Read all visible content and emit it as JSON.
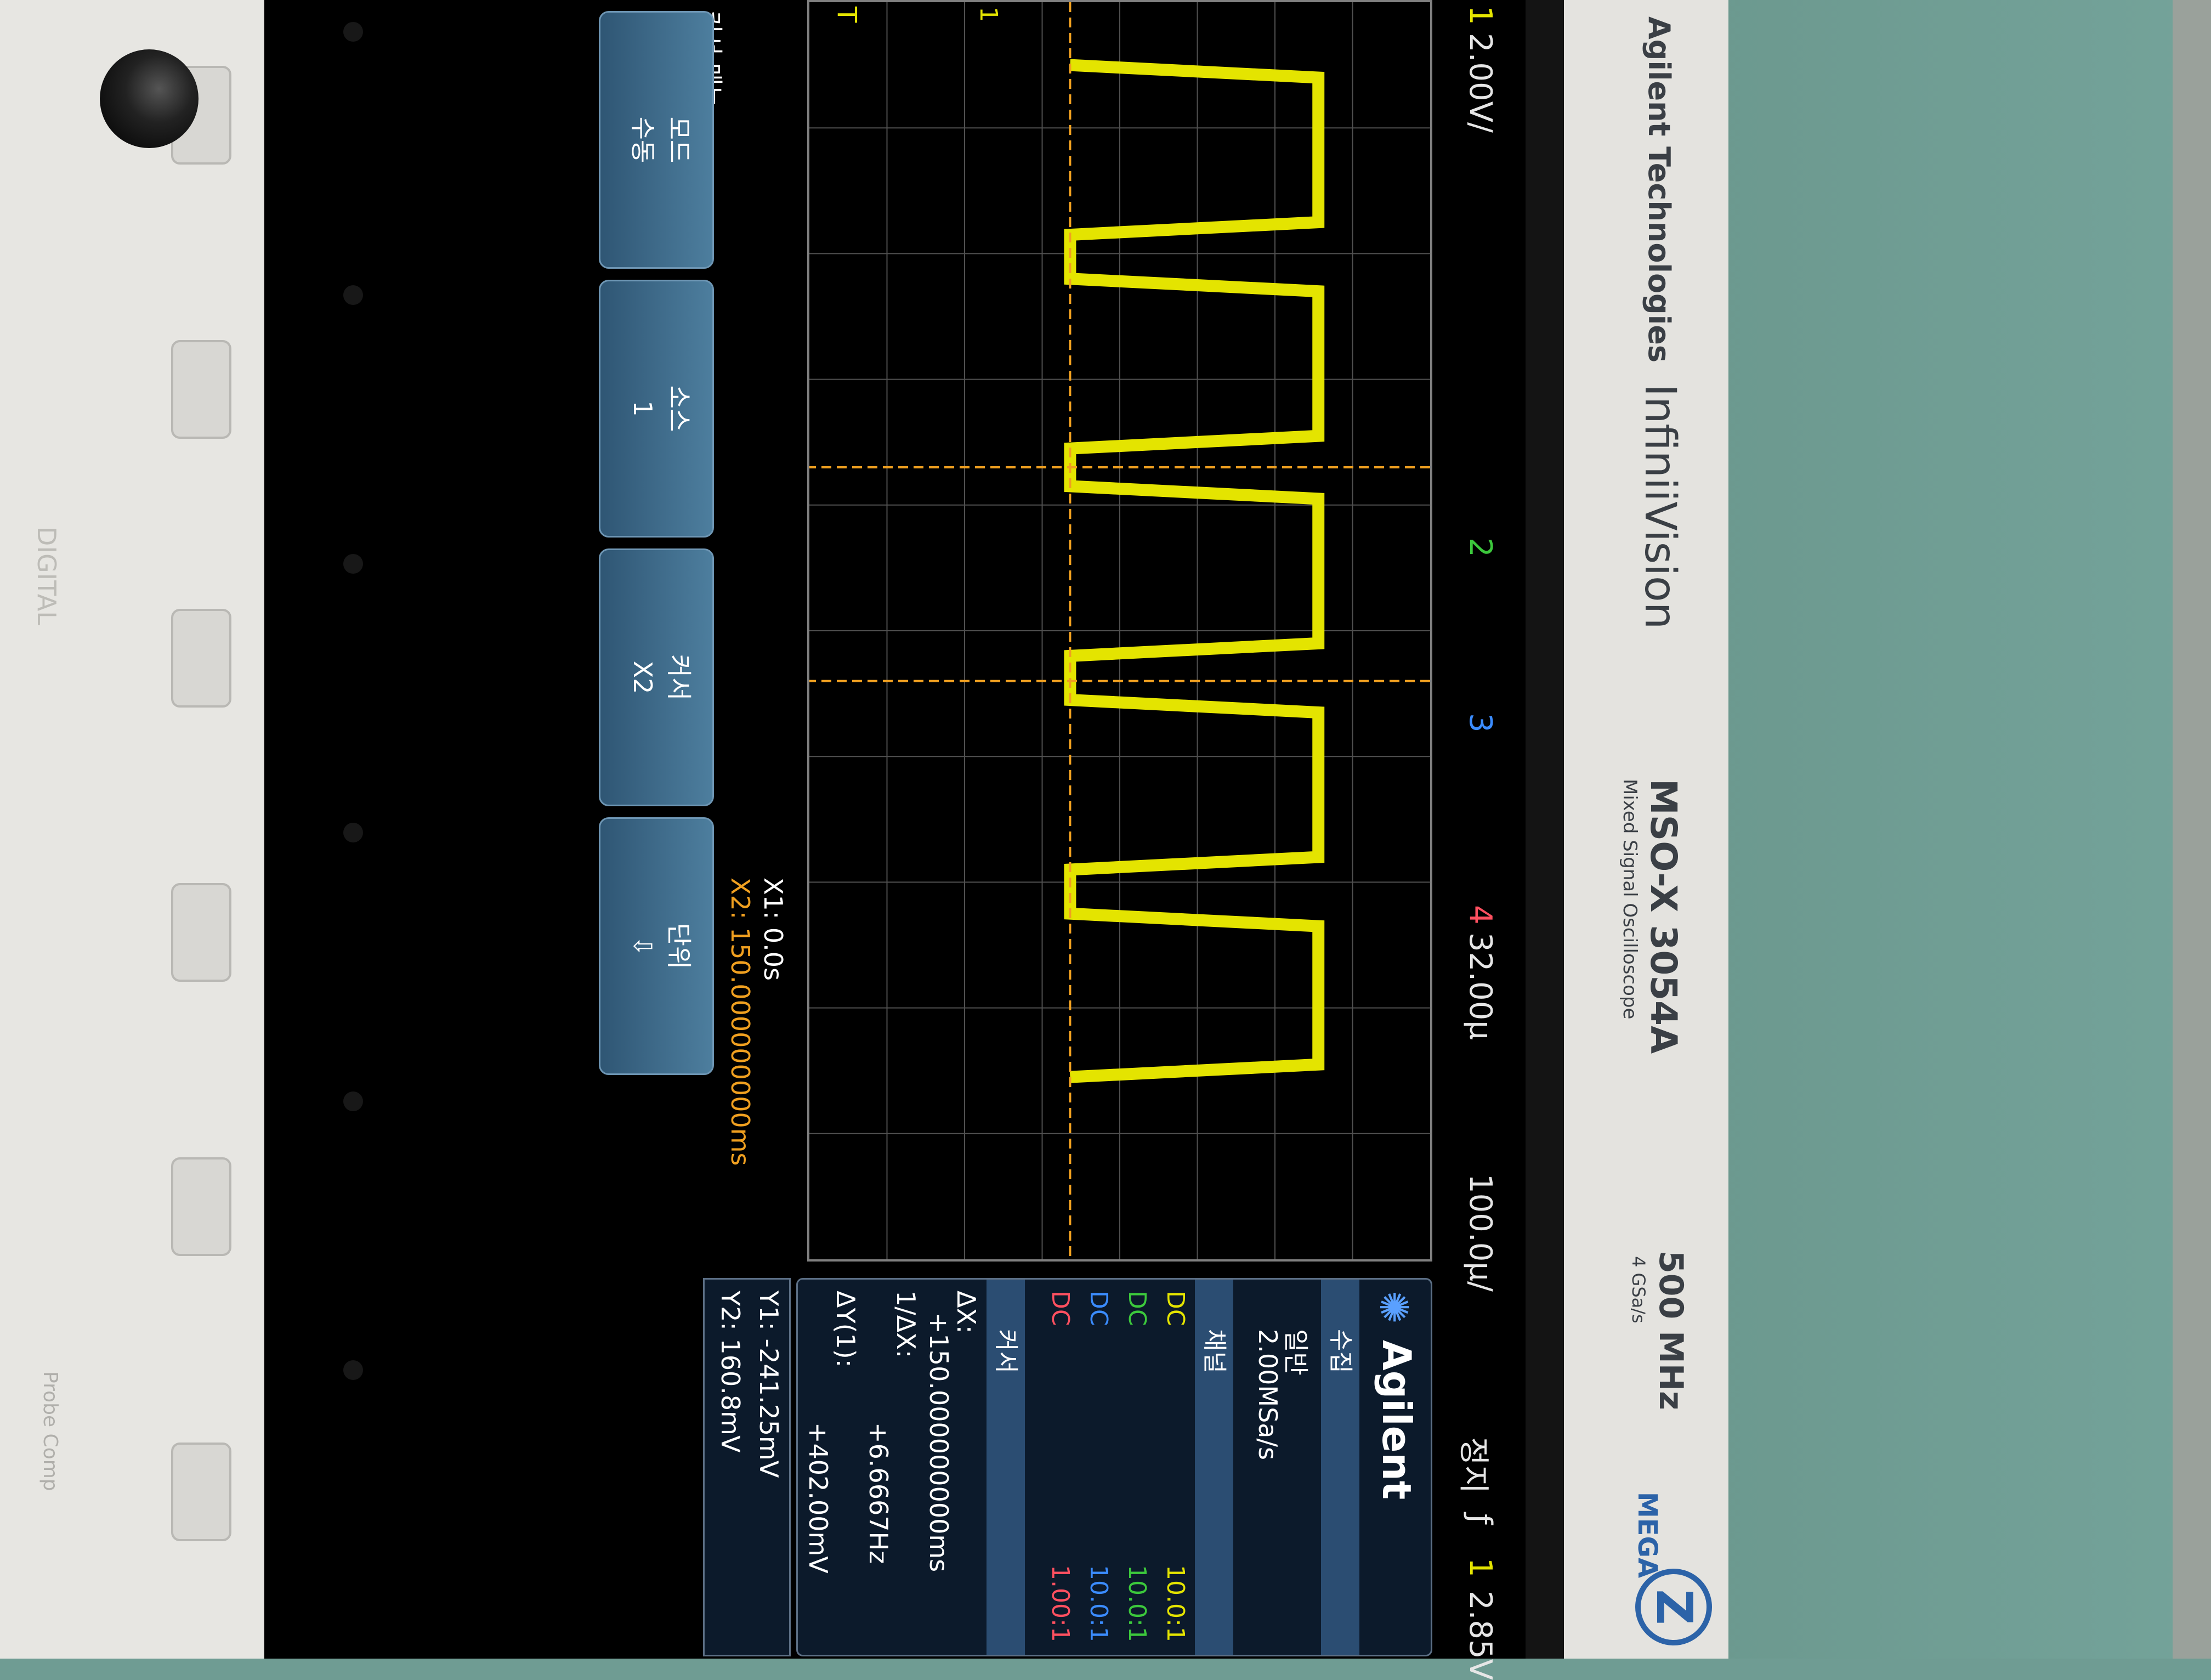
{
  "instrument": {
    "brand_left": "Agilent Technologies",
    "product": "InfiniiVision",
    "model": "MSO-X 3054A",
    "model_sub": "Mixed Signal Oscilloscope",
    "bandwidth": "500 MHz",
    "sample_rate_spec": "4 GSa/s",
    "mega_logo": "MEGA",
    "mega_z": "Z",
    "digital_label": "DIGITAL",
    "probe_comp": "Probe Comp"
  },
  "top_bar": {
    "ch1_num": "1",
    "volts_per_div": "2.00V/",
    "ch2_num": "2",
    "ch3_num": "3",
    "ch4_num": "4",
    "time_pos": "32.00µ",
    "time_per_div": "100.0µ/",
    "run_state": "정지",
    "trigger_icon": "ƒ",
    "trigger_ch": "1",
    "trigger_level": "2.85V"
  },
  "info_panel": {
    "logo": "Agilent",
    "acq_header": "수집",
    "acq_mode": "일반",
    "acq_rate": "2.00MSa/s",
    "channel_header": "채널",
    "channels": [
      {
        "coupling": "DC",
        "scale": "10.0:1",
        "color": "#e4e400"
      },
      {
        "coupling": "DC",
        "scale": "10.0:1",
        "color": "#3cc83c"
      },
      {
        "coupling": "DC",
        "scale": "10.0:1",
        "color": "#3b8cff"
      },
      {
        "coupling": "DC",
        "scale": "1.00:1",
        "color": "#ff5060"
      }
    ],
    "cursor_header": "커서",
    "dx_label": "ΔX:",
    "dx_value": "+150.000000000ms",
    "inv_dx_label": "1/ΔX:",
    "inv_dx_value": "+6.6667Hz",
    "dy_label": "ΔY(1):",
    "dy_value": "+402.00mV"
  },
  "cursor_readout": {
    "y1": "Y1: -241.25mV",
    "y2": "Y2: 160.8mV",
    "x1": "X1: 0.0s",
    "x2": "X2: 150.000000000ms"
  },
  "softkeys": {
    "menu_title": "커서 메뉴",
    "mode": {
      "label": "모드",
      "value": "수동"
    },
    "source": {
      "label": "소스",
      "value": "1"
    },
    "cursor": {
      "label": "커서",
      "value": "X2"
    },
    "units": {
      "label": "단위",
      "value": "⇩"
    }
  },
  "markers": {
    "trigger_marker": "T",
    "ground_marker": "1"
  },
  "colors": {
    "ch1": "#e4e400",
    "cursor": "#f0a020",
    "grid": "#505050",
    "softkey": "#3d6a8a"
  },
  "chart_data": {
    "type": "line",
    "title": "",
    "xlabel": "",
    "ylabel": "",
    "series": [
      {
        "name": "",
        "x_divs": [
          0.5,
          0.6,
          1.75,
          1.85,
          2.2,
          2.3,
          3.45,
          3.55,
          3.85,
          3.95,
          5.1,
          5.2,
          5.55,
          5.65,
          6.8,
          6.9,
          7.25,
          7.35,
          8.45,
          8.55
        ],
        "level": [
          "low",
          "high",
          "high",
          "low",
          "low",
          "high",
          "high",
          "low",
          "low",
          "high",
          "high",
          "low",
          "low",
          "high",
          "high",
          "low",
          "low",
          "high",
          "high",
          "low"
        ]
      }
    ],
    "cursor_x1_div": 3.7,
    "cursor_x2_div": 5.4
  }
}
